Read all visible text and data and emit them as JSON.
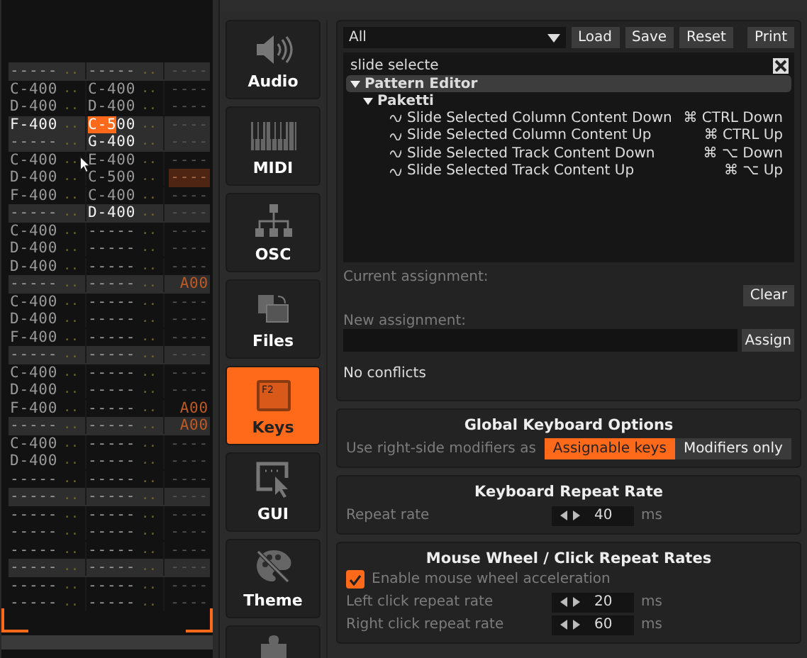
{
  "pattern": {
    "rows": [
      {
        "band": true,
        "cols": [
          {
            "note": "---",
            "inst": "--",
            "vol": "..",
            "bright": false,
            "cursor": false
          },
          {
            "note": "---",
            "inst": "--",
            "vol": "..",
            "bright": false,
            "cursor": false
          }
        ],
        "fx": "----",
        "fx_selected": false
      },
      {
        "band": false,
        "cols": [
          {
            "note": "C-4",
            "inst": "00",
            "vol": "..",
            "bright": false,
            "cursor": false
          },
          {
            "note": "C-4",
            "inst": "00",
            "vol": "..",
            "bright": false,
            "cursor": false
          }
        ],
        "fx": "----",
        "fx_selected": false
      },
      {
        "band": false,
        "cols": [
          {
            "note": "D-4",
            "inst": "00",
            "vol": "..",
            "bright": false,
            "cursor": false
          },
          {
            "note": "D-4",
            "inst": "00",
            "vol": "..",
            "bright": false,
            "cursor": false
          }
        ],
        "fx": "----",
        "fx_selected": false
      },
      {
        "band": true,
        "cols": [
          {
            "note": "F-4",
            "inst": "00",
            "vol": "..",
            "bright": true,
            "cursor": false
          },
          {
            "note": "C-5",
            "inst": "00",
            "vol": "..",
            "bright": true,
            "cursor": true
          }
        ],
        "fx": "----",
        "fx_selected": false
      },
      {
        "band": true,
        "cols": [
          {
            "note": "---",
            "inst": "--",
            "vol": "..",
            "bright": false,
            "cursor": false
          },
          {
            "note": "G-4",
            "inst": "00",
            "vol": "..",
            "bright": true,
            "cursor": false
          }
        ],
        "fx": "----",
        "fx_selected": false
      },
      {
        "band": false,
        "cols": [
          {
            "note": "C-4",
            "inst": "00",
            "vol": "..",
            "bright": false,
            "cursor": false
          },
          {
            "note": "E-4",
            "inst": "00",
            "vol": "..",
            "bright": false,
            "cursor": false
          }
        ],
        "fx": "----",
        "fx_selected": false
      },
      {
        "band": false,
        "cols": [
          {
            "note": "D-4",
            "inst": "00",
            "vol": "..",
            "bright": false,
            "cursor": false
          },
          {
            "note": "C-5",
            "inst": "00",
            "vol": "..",
            "bright": false,
            "cursor": false
          }
        ],
        "fx": "----",
        "fx_selected": true
      },
      {
        "band": false,
        "cols": [
          {
            "note": "F-4",
            "inst": "00",
            "vol": "..",
            "bright": false,
            "cursor": false
          },
          {
            "note": "C-4",
            "inst": "00",
            "vol": "..",
            "bright": false,
            "cursor": false
          }
        ],
        "fx": "----",
        "fx_selected": false
      },
      {
        "band": true,
        "cols": [
          {
            "note": "---",
            "inst": "--",
            "vol": "..",
            "bright": false,
            "cursor": false
          },
          {
            "note": "D-4",
            "inst": "00",
            "vol": "..",
            "bright": true,
            "cursor": false
          }
        ],
        "fx": "----",
        "fx_selected": false
      },
      {
        "band": false,
        "cols": [
          {
            "note": "C-4",
            "inst": "00",
            "vol": "..",
            "bright": false,
            "cursor": false
          },
          {
            "note": "---",
            "inst": "--",
            "vol": "..",
            "bright": false,
            "cursor": false
          }
        ],
        "fx": "----",
        "fx_selected": false
      },
      {
        "band": false,
        "cols": [
          {
            "note": "D-4",
            "inst": "00",
            "vol": "..",
            "bright": false,
            "cursor": false
          },
          {
            "note": "---",
            "inst": "--",
            "vol": "..",
            "bright": false,
            "cursor": false
          }
        ],
        "fx": "----",
        "fx_selected": false
      },
      {
        "band": false,
        "cols": [
          {
            "note": "D-4",
            "inst": "00",
            "vol": "..",
            "bright": false,
            "cursor": false
          },
          {
            "note": "---",
            "inst": "--",
            "vol": "..",
            "bright": false,
            "cursor": false
          }
        ],
        "fx": "----",
        "fx_selected": false
      },
      {
        "band": true,
        "cols": [
          {
            "note": "---",
            "inst": "--",
            "vol": "..",
            "bright": false,
            "cursor": false
          },
          {
            "note": "---",
            "inst": "--",
            "vol": "..",
            "bright": false,
            "cursor": false
          }
        ],
        "fx": "A00",
        "fx_selected": false
      },
      {
        "band": false,
        "cols": [
          {
            "note": "C-4",
            "inst": "00",
            "vol": "..",
            "bright": false,
            "cursor": false
          },
          {
            "note": "---",
            "inst": "--",
            "vol": "..",
            "bright": false,
            "cursor": false
          }
        ],
        "fx": "----",
        "fx_selected": false
      },
      {
        "band": false,
        "cols": [
          {
            "note": "D-4",
            "inst": "00",
            "vol": "..",
            "bright": false,
            "cursor": false
          },
          {
            "note": "---",
            "inst": "--",
            "vol": "..",
            "bright": false,
            "cursor": false
          }
        ],
        "fx": "----",
        "fx_selected": false
      },
      {
        "band": false,
        "cols": [
          {
            "note": "F-4",
            "inst": "00",
            "vol": "..",
            "bright": false,
            "cursor": false
          },
          {
            "note": "---",
            "inst": "--",
            "vol": "..",
            "bright": false,
            "cursor": false
          }
        ],
        "fx": "----",
        "fx_selected": false
      },
      {
        "band": true,
        "cols": [
          {
            "note": "---",
            "inst": "--",
            "vol": "..",
            "bright": false,
            "cursor": false
          },
          {
            "note": "---",
            "inst": "--",
            "vol": "..",
            "bright": false,
            "cursor": false
          }
        ],
        "fx": "----",
        "fx_selected": false
      },
      {
        "band": false,
        "cols": [
          {
            "note": "C-4",
            "inst": "00",
            "vol": "..",
            "bright": false,
            "cursor": false
          },
          {
            "note": "---",
            "inst": "--",
            "vol": "..",
            "bright": false,
            "cursor": false
          }
        ],
        "fx": "----",
        "fx_selected": false
      },
      {
        "band": false,
        "cols": [
          {
            "note": "D-4",
            "inst": "00",
            "vol": "..",
            "bright": false,
            "cursor": false
          },
          {
            "note": "---",
            "inst": "--",
            "vol": "..",
            "bright": false,
            "cursor": false
          }
        ],
        "fx": "----",
        "fx_selected": false
      },
      {
        "band": false,
        "cols": [
          {
            "note": "F-4",
            "inst": "00",
            "vol": "..",
            "bright": false,
            "cursor": false
          },
          {
            "note": "---",
            "inst": "--",
            "vol": "..",
            "bright": false,
            "cursor": false
          }
        ],
        "fx": "A00",
        "fx_selected": false
      },
      {
        "band": true,
        "cols": [
          {
            "note": "---",
            "inst": "--",
            "vol": "..",
            "bright": false,
            "cursor": false
          },
          {
            "note": "---",
            "inst": "--",
            "vol": "..",
            "bright": false,
            "cursor": false
          }
        ],
        "fx": "A00",
        "fx_selected": false
      },
      {
        "band": false,
        "cols": [
          {
            "note": "C-4",
            "inst": "00",
            "vol": "..",
            "bright": false,
            "cursor": false
          },
          {
            "note": "---",
            "inst": "--",
            "vol": "..",
            "bright": false,
            "cursor": false
          }
        ],
        "fx": "----",
        "fx_selected": false
      },
      {
        "band": false,
        "cols": [
          {
            "note": "D-4",
            "inst": "00",
            "vol": "..",
            "bright": false,
            "cursor": false
          },
          {
            "note": "---",
            "inst": "--",
            "vol": "..",
            "bright": false,
            "cursor": false
          }
        ],
        "fx": "----",
        "fx_selected": false
      },
      {
        "band": false,
        "cols": [
          {
            "note": "---",
            "inst": "--",
            "vol": "..",
            "bright": false,
            "cursor": false
          },
          {
            "note": "---",
            "inst": "--",
            "vol": "..",
            "bright": false,
            "cursor": false
          }
        ],
        "fx": "----",
        "fx_selected": false
      },
      {
        "band": true,
        "cols": [
          {
            "note": "---",
            "inst": "--",
            "vol": "..",
            "bright": false,
            "cursor": false
          },
          {
            "note": "---",
            "inst": "--",
            "vol": "..",
            "bright": false,
            "cursor": false
          }
        ],
        "fx": "----",
        "fx_selected": false
      },
      {
        "band": false,
        "cols": [
          {
            "note": "---",
            "inst": "--",
            "vol": "..",
            "bright": false,
            "cursor": false
          },
          {
            "note": "---",
            "inst": "--",
            "vol": "..",
            "bright": false,
            "cursor": false
          }
        ],
        "fx": "----",
        "fx_selected": false
      },
      {
        "band": false,
        "cols": [
          {
            "note": "---",
            "inst": "--",
            "vol": "..",
            "bright": false,
            "cursor": false
          },
          {
            "note": "---",
            "inst": "--",
            "vol": "..",
            "bright": false,
            "cursor": false
          }
        ],
        "fx": "----",
        "fx_selected": false
      },
      {
        "band": false,
        "cols": [
          {
            "note": "---",
            "inst": "--",
            "vol": "..",
            "bright": false,
            "cursor": false
          },
          {
            "note": "---",
            "inst": "--",
            "vol": "..",
            "bright": false,
            "cursor": false
          }
        ],
        "fx": "----",
        "fx_selected": false
      },
      {
        "band": true,
        "cols": [
          {
            "note": "---",
            "inst": "--",
            "vol": "..",
            "bright": false,
            "cursor": false
          },
          {
            "note": "---",
            "inst": "--",
            "vol": "..",
            "bright": false,
            "cursor": false
          }
        ],
        "fx": "----",
        "fx_selected": false
      },
      {
        "band": false,
        "cols": [
          {
            "note": "---",
            "inst": "--",
            "vol": "..",
            "bright": false,
            "cursor": false
          },
          {
            "note": "---",
            "inst": "--",
            "vol": "..",
            "bright": false,
            "cursor": false
          }
        ],
        "fx": "----",
        "fx_selected": false
      },
      {
        "band": false,
        "cols": [
          {
            "note": "---",
            "inst": "--",
            "vol": "..",
            "bright": false,
            "cursor": false
          },
          {
            "note": "---",
            "inst": "--",
            "vol": "..",
            "bright": false,
            "cursor": false
          }
        ],
        "fx": "----",
        "fx_selected": false
      }
    ]
  },
  "sidebar": {
    "items": [
      {
        "kind": "speaker",
        "label": "Audio",
        "selected": false
      },
      {
        "kind": "piano",
        "label": "MIDI",
        "selected": false
      },
      {
        "kind": "network",
        "label": "OSC",
        "selected": false
      },
      {
        "kind": "files",
        "label": "Files",
        "selected": false
      },
      {
        "kind": "key",
        "key_label": "F2",
        "label": "Keys",
        "selected": true
      },
      {
        "kind": "gui",
        "label": "GUI",
        "selected": false
      },
      {
        "kind": "palette",
        "label": "Theme",
        "selected": false
      },
      {
        "kind": "puzzle",
        "selected": false
      }
    ]
  },
  "keys": {
    "filter": "All",
    "buttons": [
      "Load",
      "Save",
      "Reset",
      "Print"
    ],
    "search": {
      "value": "slide selecte"
    },
    "tree": [
      {
        "label": "Pattern Editor",
        "expanded": true,
        "selected": true,
        "children": [
          {
            "label": "Paketti",
            "expanded": true,
            "selected": false,
            "children": [
              {
                "label": "Slide Selected Column Content Down",
                "shortcut": "⌘ CTRL Down"
              },
              {
                "label": "Slide Selected Column Content Up",
                "shortcut": "⌘ CTRL Up"
              },
              {
                "label": "Slide Selected Track Content Down",
                "shortcut": "⌘ ⌥ Down"
              },
              {
                "label": "Slide Selected Track Content Up",
                "shortcut": "⌘ ⌥ Up"
              }
            ]
          }
        ]
      }
    ],
    "current_label": "Current assignment:",
    "clear": "Clear",
    "new_label": "New assignment:",
    "assign": "Assign",
    "conflicts": "No conflicts"
  },
  "global": {
    "title": "Global Keyboard Options",
    "label": "Use right-side modifiers as",
    "options": [
      {
        "label": "Assignable keys",
        "selected": true
      },
      {
        "label": "Modifiers only",
        "selected": false
      }
    ]
  },
  "repeat": {
    "title": "Keyboard Repeat Rate",
    "rows": [
      {
        "label": "Repeat rate",
        "value": "40",
        "unit": "ms"
      }
    ]
  },
  "mouse": {
    "title": "Mouse Wheel / Click Repeat Rates",
    "checkbox": {
      "label": "Enable mouse wheel acceleration",
      "checked": true
    },
    "rows": [
      {
        "label": "Left click repeat rate",
        "value": "20",
        "unit": "ms"
      },
      {
        "label": "Right click repeat rate",
        "value": "60",
        "unit": "ms"
      }
    ]
  }
}
